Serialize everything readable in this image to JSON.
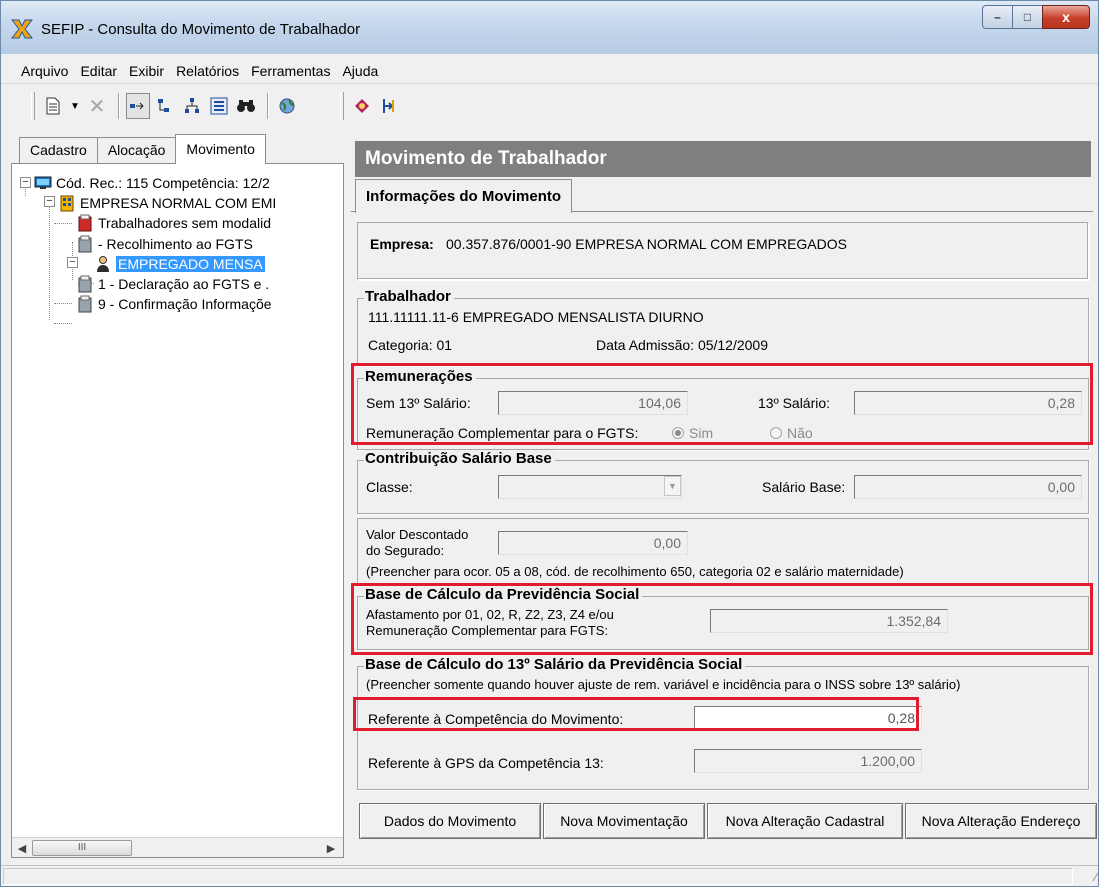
{
  "window": {
    "title": "SEFIP - Consulta do Movimento de Trabalhador",
    "minimize": "–",
    "maximize": "□",
    "close": "x"
  },
  "menu": [
    "Arquivo",
    "Editar",
    "Exibir",
    "Relatórios",
    "Ferramentas",
    "Ajuda"
  ],
  "left_tabs": [
    "Cadastro",
    "Alocação",
    "Movimento"
  ],
  "tree": {
    "root": "Cód. Rec.: 115 Competência: 12/2",
    "company": "EMPRESA NORMAL COM EMI",
    "workers_without_modality": "Trabalhadores sem modalid",
    "fgts_collection": "- Recolhimento ao FGTS",
    "selected_worker": "EMPREGADO MENSA",
    "declaration": "1 - Declaração ao FGTS e .",
    "confirmation": "9 - Confirmação Informaçõe"
  },
  "scrollbar_thumb": "III",
  "right": {
    "header": "Movimento de Trabalhador",
    "tab": "Informações do Movimento",
    "empresa_label": "Empresa:",
    "empresa_value": "00.357.876/0001-90  EMPRESA NORMAL COM EMPREGADOS",
    "trabalhador": {
      "title": "Trabalhador",
      "line": "111.11111.11-6 EMPREGADO MENSALISTA DIURNO",
      "categoria": "Categoria: 01",
      "admissao": "Data Admissão: 05/12/2009"
    },
    "remuneracoes": {
      "title": "Remunerações",
      "sem13_label": "Sem 13º Salário:",
      "sem13_value": "104,06",
      "s13_label": "13º Salário:",
      "s13_value": "0,28",
      "complementar_label": "Remuneração Complementar para o FGTS:",
      "opt_sim": "Sim",
      "opt_nao": "Não",
      "selected": "Sim"
    },
    "contribuicao": {
      "title": "Contribuição Salário Base",
      "classe_label": "Classe:",
      "classe_value": "",
      "base_label": "Salário Base:",
      "base_value": "0,00"
    },
    "descontado": {
      "label_1": "Valor Descontado",
      "label_2": "do Segurado:",
      "value": "0,00",
      "note": "(Preencher para ocor. 05 a 08, cód. de recolhimento 650, categoria 02 e salário maternidade)"
    },
    "base_previdencia": {
      "title": "Base de Cálculo da Previdência Social",
      "label_1": "Afastamento por 01, 02, R, Z2, Z3, Z4 e/ou",
      "label_2": "Remuneração Complementar para FGTS:",
      "value": "1.352,84"
    },
    "base_13": {
      "title": "Base de Cálculo do 13º Salário da Previdência Social",
      "note": "(Preencher somente quando houver ajuste de rem. variável e incidência para o INSS sobre 13º salário)",
      "ref_mov_label": "Referente à Competência do Movimento:",
      "ref_mov_value": "0,28",
      "ref_gps_label": "Referente à GPS da Competência 13:",
      "ref_gps_value": "1.200,00"
    },
    "buttons": [
      "Dados do Movimento",
      "Nova Movimentação",
      "Nova Alteração Cadastral",
      "Nova Alteração Endereço"
    ]
  },
  "colors": {
    "highlight": "#e21b2e",
    "header_bg": "#7f7f7f",
    "selection": "#3399ff"
  }
}
